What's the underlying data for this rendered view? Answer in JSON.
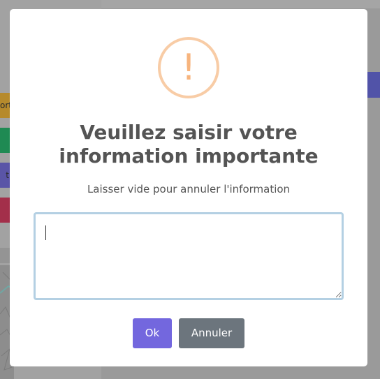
{
  "background": {
    "tabs": [
      {
        "label": "ort",
        "color": "#b68a2c"
      },
      {
        "label": "",
        "color": "#1f8a53"
      },
      {
        "label": "t",
        "color": "#5a55a7"
      },
      {
        "label": "",
        "color": "#a32f4a"
      }
    ]
  },
  "dialog": {
    "icon": "!",
    "icon_name": "warning-icon",
    "icon_color": "#f8bb86",
    "title": "Veuillez saisir votre information importante",
    "subtitle": "Laisser vide pour annuler l'information",
    "input": {
      "value": "",
      "placeholder": ""
    },
    "confirm_label": "Ok",
    "cancel_label": "Annuler",
    "confirm_color": "#7367de",
    "cancel_color": "#6c757d"
  }
}
